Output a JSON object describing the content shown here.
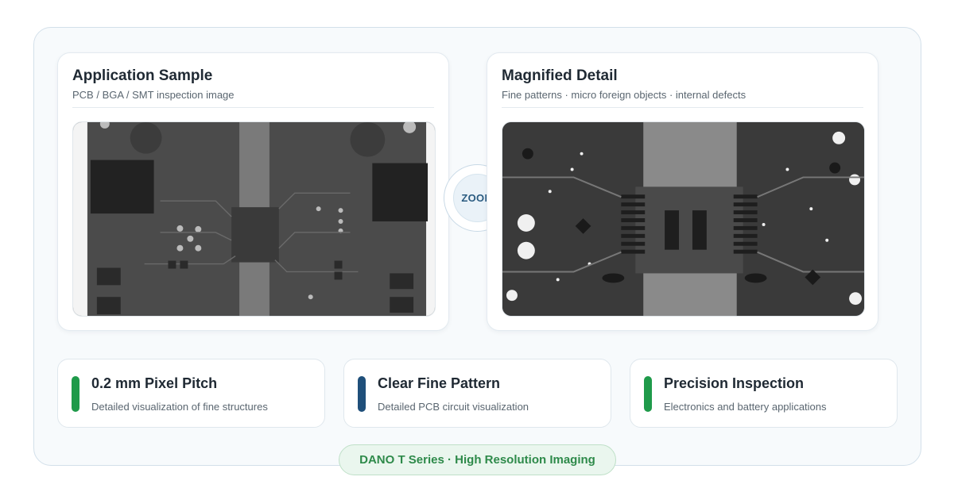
{
  "colors": {
    "frame_bg": "#f7fafc",
    "accent_green": "#1f9a4a",
    "accent_blue": "#1f4f7a",
    "pill_text": "#2e8a4a"
  },
  "left_card": {
    "title": "Application Sample",
    "subtitle": "PCB / BGA / SMT inspection image",
    "image_icon": "pcb-xray-image"
  },
  "right_card": {
    "title": "Magnified Detail",
    "subtitle": "Fine patterns · micro foreign objects · internal defects",
    "image_icon": "pcb-xray-zoom-image"
  },
  "zoom_badge": {
    "label": "ZOOM"
  },
  "features": [
    {
      "title": "0.2 mm Pixel Pitch",
      "desc": "Detailed visualization of fine structures",
      "accent": "#1f9a4a"
    },
    {
      "title": "Clear Fine Pattern",
      "desc": "Detailed PCB circuit visualization",
      "accent": "#1f4f7a"
    },
    {
      "title": "Precision Inspection",
      "desc": "Electronics and battery applications",
      "accent": "#1f9a4a"
    }
  ],
  "footer_badge": {
    "label": "DANO T Series · High Resolution Imaging"
  }
}
